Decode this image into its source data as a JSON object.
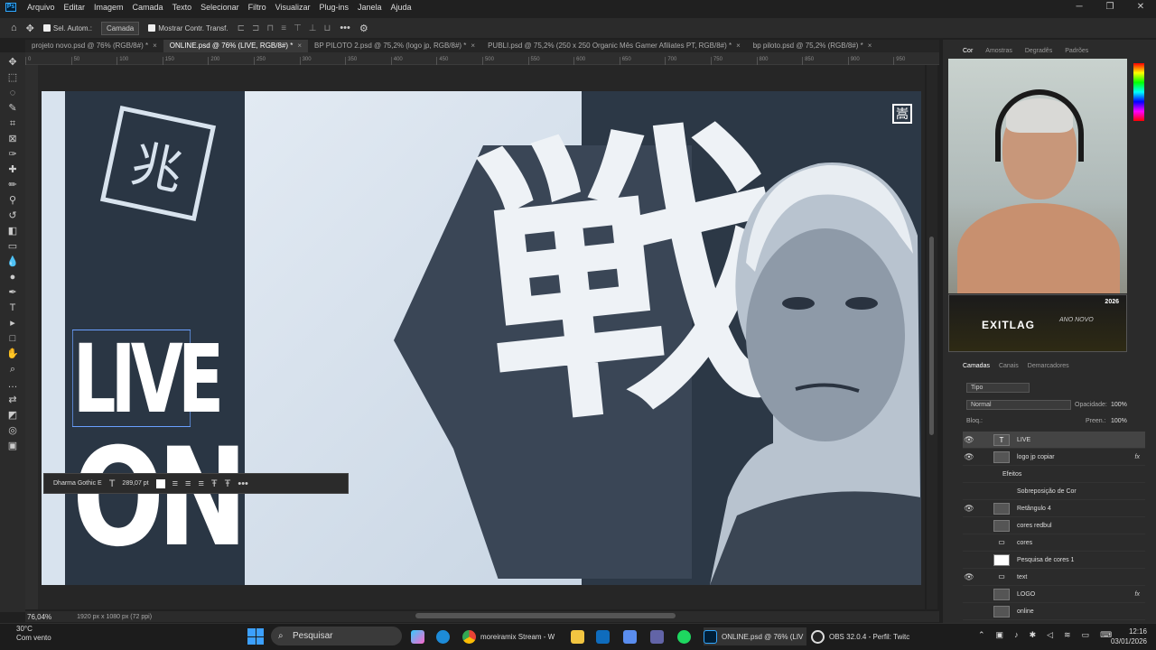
{
  "menu": {
    "items": [
      "Arquivo",
      "Editar",
      "Imagem",
      "Camada",
      "Texto",
      "Selecionar",
      "Filtro",
      "Visualizar",
      "Plug-ins",
      "Janela",
      "Ajuda"
    ],
    "logo": "Ps"
  },
  "options": {
    "auto_select": "Sel. Autom.:",
    "layer_select": "Camada",
    "show_transform": "Mostrar Contr. Transf.",
    "more": "•••"
  },
  "tabs": [
    {
      "label": "projeto novo.psd @ 76% (RGB/8#) *",
      "active": false
    },
    {
      "label": "ONLINE.psd @ 76% (LIVE, RGB/8#) *",
      "active": true
    },
    {
      "label": "BP PILOTO 2.psd @ 75,2% (logo jp, RGB/8#) *",
      "active": false
    },
    {
      "label": "PUBLI.psd @ 75,2% (250 x 250 Organic Mês Gamer Afiliates PT, RGB/8#) *",
      "active": false
    },
    {
      "label": "bp piloto.psd @ 75,2% (RGB/8#) *",
      "active": false
    }
  ],
  "ruler": [
    "0",
    "50",
    "100",
    "150",
    "200",
    "250",
    "300",
    "350",
    "400",
    "450",
    "500",
    "550",
    "600",
    "650",
    "700",
    "750",
    "800",
    "850",
    "900",
    "950"
  ],
  "canvas": {
    "live_text": "LIVE",
    "on_text": "ON",
    "corner_logo": "嵩"
  },
  "typebar": {
    "font": "Dharma Gothic E",
    "size": "289,07 pt",
    "more": "•••"
  },
  "status": {
    "zoom": "76,04%",
    "dims": "1920 px x 1080 px (72 ppi)"
  },
  "color_tabs": [
    "Cor",
    "Amostras",
    "Degradês",
    "Padrões"
  ],
  "exitlag": {
    "brand": "EXITLAG",
    "year": "2026",
    "ano": "ANO",
    "novo": "NOVO"
  },
  "layers_tabs": [
    "Camadas",
    "Canais",
    "Demarcadores"
  ],
  "layers_panel": {
    "filter": "Tipo",
    "blend": "Normal",
    "opacity_label": "Opacidade:",
    "opacity": "100%",
    "lock_label": "Bloq.:",
    "fill_label": "Preen.:",
    "fill": "100%"
  },
  "layers": [
    {
      "name": "LIVE",
      "thumb": "T",
      "selected": true,
      "fx": ""
    },
    {
      "name": "logo jp copiar",
      "thumb": "",
      "selected": false,
      "fx": "fx"
    },
    {
      "name": "Efeitos",
      "thumb": "",
      "selected": false,
      "fx": ""
    },
    {
      "name": "Sobreposição de Cor",
      "thumb": "",
      "selected": false,
      "fx": ""
    },
    {
      "name": "Retângulo 4",
      "thumb": "",
      "selected": false,
      "fx": ""
    },
    {
      "name": "cores redbul",
      "thumb": "",
      "selected": false,
      "fx": ""
    },
    {
      "name": "cores",
      "thumb": "",
      "selected": false,
      "fx": ""
    },
    {
      "name": "Pesquisa de cores 1",
      "thumb": "",
      "selected": false,
      "fx": ""
    },
    {
      "name": "text",
      "thumb": "",
      "selected": false,
      "fx": ""
    },
    {
      "name": "LOGO",
      "thumb": "",
      "selected": false,
      "fx": "fx"
    },
    {
      "name": "online",
      "thumb": "",
      "selected": false,
      "fx": ""
    }
  ],
  "taskbar": {
    "temp": "30°C",
    "weather": "Com vento",
    "search": "Pesquisar",
    "chrome": "moreiramix Stream - W",
    "ps": "ONLINE.psd @ 76% (LIV",
    "obs": "OBS 32.0.4 - Perfil: Twitc",
    "time": "12:16",
    "date": "03/01/2026"
  }
}
